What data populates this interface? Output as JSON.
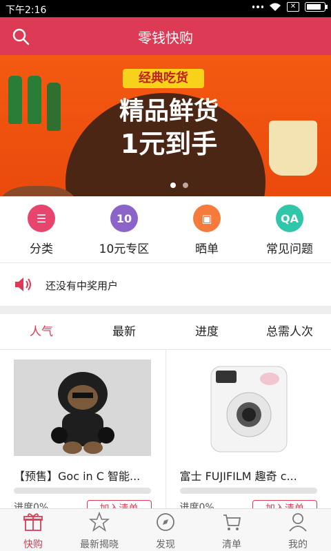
{
  "status_bar": {
    "time": "下午2:16"
  },
  "header": {
    "title": "零钱快购"
  },
  "banner": {
    "tag": "经典吃货",
    "headline_line1": "精品鲜货",
    "headline_line2": "1元到手"
  },
  "quick_actions": [
    {
      "label": "分类",
      "icon": "list-icon",
      "color": "#e8456e"
    },
    {
      "label": "10元专区",
      "icon": "ten-icon",
      "color": "#8b64c9"
    },
    {
      "label": "晒单",
      "icon": "picture-icon",
      "color": "#f47b3b"
    },
    {
      "label": "常见问题",
      "icon": "qa-icon",
      "color": "#2fc6a9"
    }
  ],
  "notice": {
    "text": "还没有中奖用户"
  },
  "sort_tabs": [
    "人气",
    "最新",
    "进度",
    "总需人次"
  ],
  "products": [
    {
      "name": "【预售】Goc in C 智能...",
      "progress_text": "进度0%",
      "button_label": "加入清单"
    },
    {
      "name": "富士 FUJIFILM 趣奇 c...",
      "progress_text": "进度0%",
      "button_label": "加入清单"
    }
  ],
  "bottom_nav": [
    {
      "label": "快购",
      "icon": "gift-icon"
    },
    {
      "label": "最新揭晓",
      "icon": "star-icon"
    },
    {
      "label": "发现",
      "icon": "compass-icon"
    },
    {
      "label": "清单",
      "icon": "cart-icon"
    },
    {
      "label": "我的",
      "icon": "user-icon"
    }
  ],
  "colors": {
    "brand": "#dc3a55"
  }
}
